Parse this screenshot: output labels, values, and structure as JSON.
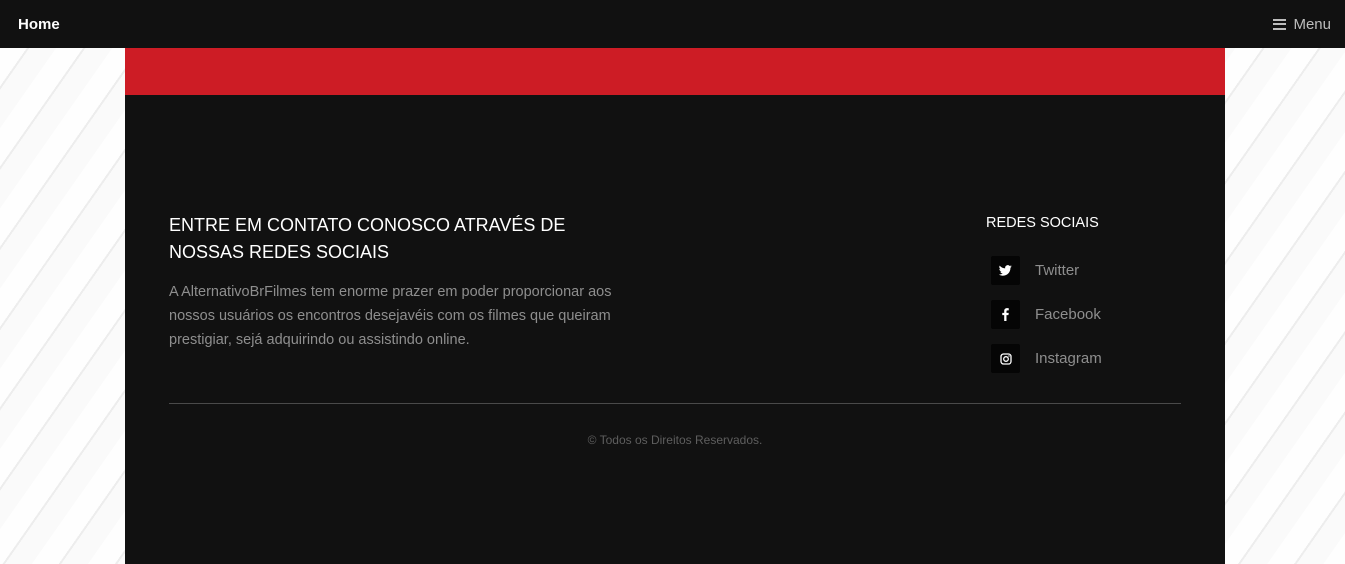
{
  "nav": {
    "brand": "Home",
    "menu_label": "Menu",
    "menu_icon": "bars-icon"
  },
  "colors": {
    "navbar_bg": "#111111",
    "accent_red": "#cd1c25",
    "panel_bg": "#111111",
    "text_muted": "#8e8e8e"
  },
  "contact": {
    "heading": "ENTRE EM CONTATO CONOSCO ATRAVÉS DE NOSSAS REDES SOCIAIS",
    "description": "A AlternativoBrFilmes tem enorme prazer em poder proporcionar aos nossos usuários os encontros desejavéis com os filmes que queiram prestigiar, sejá adquirindo ou assistindo online."
  },
  "social": {
    "heading": "REDES SOCIAIS",
    "items": [
      {
        "label": "Twitter",
        "icon": "twitter-icon"
      },
      {
        "label": "Facebook",
        "icon": "facebook-icon"
      },
      {
        "label": "Instagram",
        "icon": "instagram-icon"
      }
    ]
  },
  "footer": {
    "copyright": "© Todos os Direitos Reservados."
  }
}
